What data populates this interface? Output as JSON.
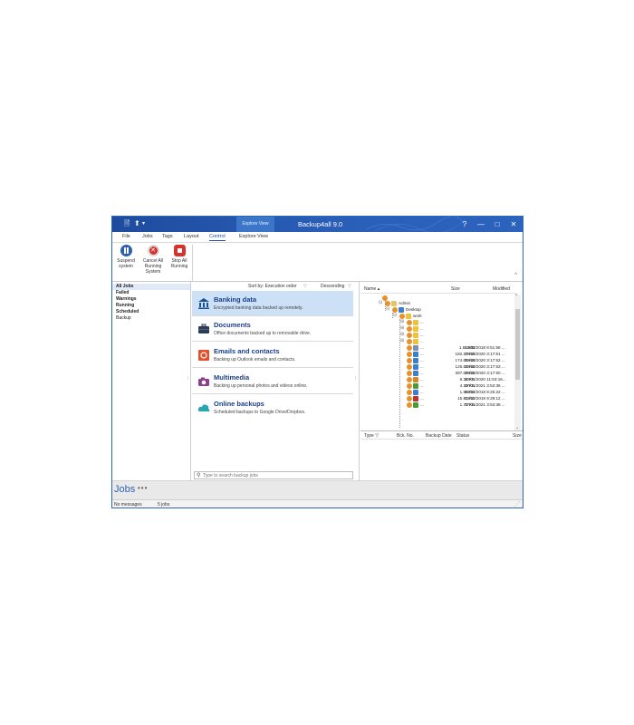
{
  "window": {
    "quick_access": {
      "file_icon": "document-icon",
      "up_icon": "arrow-up-icon",
      "dropdown_icon": "chevron-down-icon"
    },
    "context_tab": "Explore View",
    "title": "Backup4all 9.0",
    "controls": {
      "help": "?",
      "minimize": "—",
      "maximize": "□",
      "close": "✕"
    }
  },
  "menu": [
    "File",
    "Jobs",
    "Tags",
    "Layout",
    "Control",
    "Explore View"
  ],
  "menu_active": "Control",
  "ribbon": {
    "suspend": "Suspend system",
    "cancel_all": "Cancel All Running System",
    "stop_all": "Stop All Running"
  },
  "filters": [
    "All Jobs",
    "Failed",
    "Warnings",
    "Running",
    "Scheduled",
    "Backup"
  ],
  "sort": {
    "label": "Sort by: Execution order",
    "order": "Descending"
  },
  "jobs": [
    {
      "title": "Banking data",
      "desc": "Encrypted banking data backed up remotely."
    },
    {
      "title": "Documents",
      "desc": "Office documents backed up to removable drive."
    },
    {
      "title": "Emails and contacts",
      "desc": "Backing up Outlook emails and contacts."
    },
    {
      "title": "Multimedia",
      "desc": "Backing up personal photos and videos online."
    },
    {
      "title": "Online backups",
      "desc": "Scheduled backups to Google Drive/Dropbox."
    }
  ],
  "search": {
    "placeholder": "Type to search backup jobs"
  },
  "explorer": {
    "columns": {
      "name": "Name",
      "size": "Size",
      "modified": "Modified"
    },
    "tree": {
      "root": "Admin",
      "desktop": "Desktop",
      "work": "work"
    },
    "files": [
      {
        "name": "...",
        "size": "",
        "modified": ""
      },
      {
        "name": "...",
        "size": "",
        "modified": ""
      },
      {
        "name": "...",
        "size": "",
        "modified": ""
      },
      {
        "name": "...",
        "size": "",
        "modified": ""
      },
      {
        "name": "...",
        "size": "1.55 MB",
        "modified": "12/03/2018 8:51:58 ..."
      },
      {
        "name": "...",
        "size": "182.27 KB",
        "modified": "29/10/2020 3:17:51 ..."
      },
      {
        "name": "...",
        "size": "174.65 KB",
        "modified": "29/10/2020 3:17:52 ..."
      },
      {
        "name": "...",
        "size": "125.61 KB",
        "modified": "29/10/2020 3:17:53 ..."
      },
      {
        "name": "...",
        "size": "387.03 KB",
        "modified": "29/10/2020 3:17:50 ..."
      },
      {
        "name": "...",
        "size": "6.34 KB",
        "modified": "20/01/2020 11:53:16..."
      },
      {
        "name": "...",
        "size": "4.10 KB",
        "modified": "07/01/2021 3:53:36 ..."
      },
      {
        "name": "...",
        "size": "1.99 KB",
        "modified": "13/12/2018 8:25:22 ..."
      },
      {
        "name": "...",
        "size": "15.81 KB",
        "modified": "03/12/2019 9:29:12 ..."
      },
      {
        "name": "...",
        "size": "1.72 KB",
        "modified": "07/01/2021 3:53:38 ..."
      }
    ]
  },
  "history": {
    "type": "Type",
    "bck_no": "Bck. No.",
    "backup_date": "Backup Date",
    "status": "Status",
    "size": "Size"
  },
  "jobs_bar": {
    "title": "Jobs",
    "more": "•••"
  },
  "status": {
    "messages": "No messages",
    "count": "5 jobs"
  },
  "colors": {
    "title_bar": "#1f4fa3",
    "accent": "#2b63b5",
    "selection": "#cce0f6",
    "job_title": "#1a3f8c"
  }
}
